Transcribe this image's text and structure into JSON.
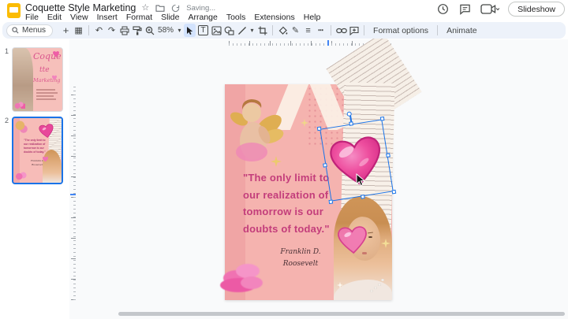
{
  "header": {
    "title": "Coquette Style Marketing",
    "saving_status": "Saving...",
    "menus": [
      "File",
      "Edit",
      "View",
      "Insert",
      "Format",
      "Slide",
      "Arrange",
      "Tools",
      "Extensions",
      "Help"
    ],
    "slideshow_label": "Slideshow"
  },
  "toolbar": {
    "menus_label": "Menus",
    "zoom_level": "58%",
    "format_options_label": "Format options",
    "animate_label": "Animate"
  },
  "icons": {
    "plus": "+",
    "layouts": "▦",
    "undo": "↶",
    "redo": "↷",
    "dropdown": "▾",
    "text_box": "T",
    "pen": "✎",
    "border_weight": "≡",
    "border_dash": "┅",
    "star": "☆"
  },
  "filmstrip": {
    "slide1_number": "1",
    "slide2_number": "2",
    "thumb1": {
      "line1": "Coque",
      "line2": "tte",
      "line3": "Marketing"
    }
  },
  "canvas": {
    "quote_lines": [
      "\"The only limit to",
      "our realization of",
      "tomorrow is our",
      "doubts of today.\""
    ],
    "attribution": [
      "Franklin D.",
      "Roosevelt"
    ]
  },
  "colors": {
    "toolbar_bg": "#edf2fa",
    "active_tool_bg": "#d3e3fd",
    "selection_blue": "#1a73e8",
    "slide_pink": "#f5b3af",
    "quote_pink": "#c33d7b",
    "heart_pink": "#ee4f9f"
  }
}
